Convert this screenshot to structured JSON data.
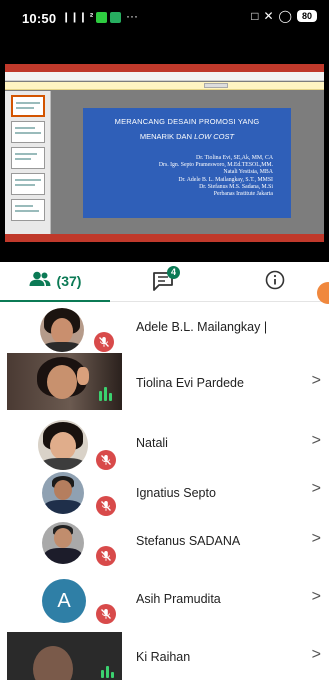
{
  "status_bar": {
    "time": "10:50",
    "signal": "❙❙❙ ²❙❙❙",
    "overflow": "···",
    "battery": "80"
  },
  "slide": {
    "title_line1": "MERANCANG DESAIN PROMOSI YANG",
    "title_line2": "MENARIK DAN",
    "title_line2_italic": "LOW COST",
    "authors": [
      "Dr. Tiolina Evi, SE,Ak, MM, CA",
      "Drs. Ign. Septo Pramesworo,  M.Ed.TESOL,MM.",
      "Natali Yestisia, MBA",
      "Dr. Adele B. L. Mailangkay, S.T., MMSI",
      "Dr. Stefanus M.S. Sadana, M.Si",
      "Perbanas Institute Jakarta"
    ]
  },
  "tabs": {
    "people_count": "(37)",
    "chat_badge": "4"
  },
  "participants": [
    {
      "name": "Adele B.L. Mailangkay |",
      "muted": true,
      "chevron": ""
    },
    {
      "name": "Tiolina Evi Pardede",
      "muted": false,
      "chevron": ">"
    },
    {
      "name": "Natali",
      "muted": true,
      "chevron": ">"
    },
    {
      "name": "Ignatius Septo",
      "muted": true,
      "chevron": ">"
    },
    {
      "name": "Stefanus SADANA",
      "muted": true,
      "chevron": ">"
    },
    {
      "name": "Asih Pramudita",
      "muted": true,
      "chevron": ">",
      "initial": "A"
    },
    {
      "name": "Ki Raihan",
      "muted": false,
      "chevron": ">"
    }
  ],
  "colors": {
    "accent": "#0b7a55",
    "mute": "#d84a4a",
    "slide_bg": "#2f5fb8",
    "speaking": "#3bd16f"
  }
}
